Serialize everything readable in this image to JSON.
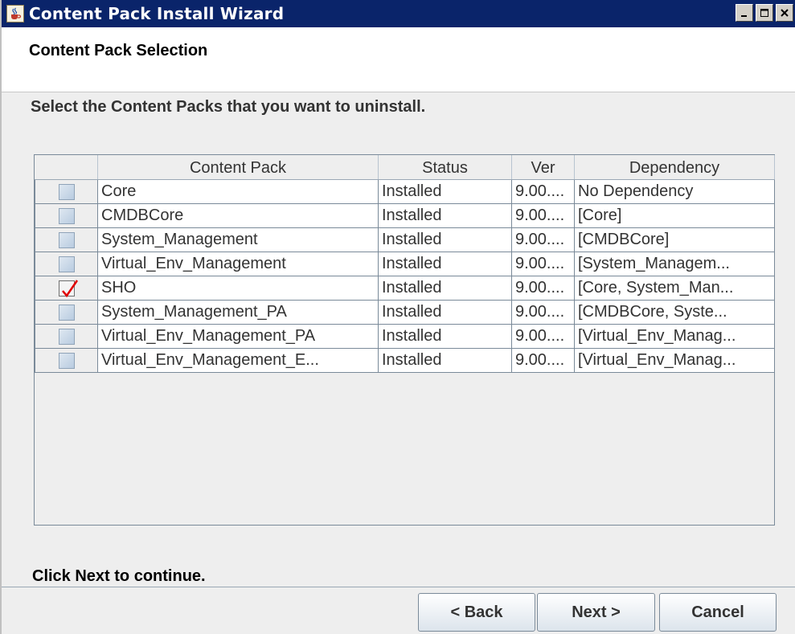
{
  "window": {
    "title": "Content Pack Install Wizard",
    "icon": "java-coffee-icon",
    "controls": [
      "minimize-icon",
      "maximize-icon",
      "close-icon"
    ]
  },
  "header": {
    "title": "Content Pack Selection"
  },
  "instruction": "Select the Content Packs that you want to uninstall.",
  "table": {
    "columns": [
      "",
      "Content Pack",
      "Status",
      "Ver",
      "Dependency"
    ],
    "rows": [
      {
        "checked": false,
        "pack": "Core",
        "status": "Installed",
        "ver": "9.00....",
        "dependency": "No Dependency"
      },
      {
        "checked": false,
        "pack": "CMDBCore",
        "status": "Installed",
        "ver": "9.00....",
        "dependency": "[Core]"
      },
      {
        "checked": false,
        "pack": "System_Management",
        "status": "Installed",
        "ver": "9.00....",
        "dependency": "[CMDBCore]"
      },
      {
        "checked": false,
        "pack": "Virtual_Env_Management",
        "status": "Installed",
        "ver": "9.00....",
        "dependency": "[System_Managem..."
      },
      {
        "checked": true,
        "pack": "SHO",
        "status": "Installed",
        "ver": "9.00....",
        "dependency": "[Core, System_Man..."
      },
      {
        "checked": false,
        "pack": "System_Management_PA",
        "status": "Installed",
        "ver": "9.00....",
        "dependency": "[CMDBCore, Syste..."
      },
      {
        "checked": false,
        "pack": "Virtual_Env_Management_PA",
        "status": "Installed",
        "ver": "9.00....",
        "dependency": "[Virtual_Env_Manag..."
      },
      {
        "checked": false,
        "pack": "Virtual_Env_Management_E...",
        "status": "Installed",
        "ver": "9.00....",
        "dependency": "[Virtual_Env_Manag..."
      }
    ]
  },
  "footer": {
    "hint": "Click Next to continue.",
    "back_label": "< Back",
    "next_label": "Next >",
    "cancel_label": "Cancel"
  },
  "colors": {
    "titlebar": "#0a246a",
    "checkmark": "#e00000"
  }
}
